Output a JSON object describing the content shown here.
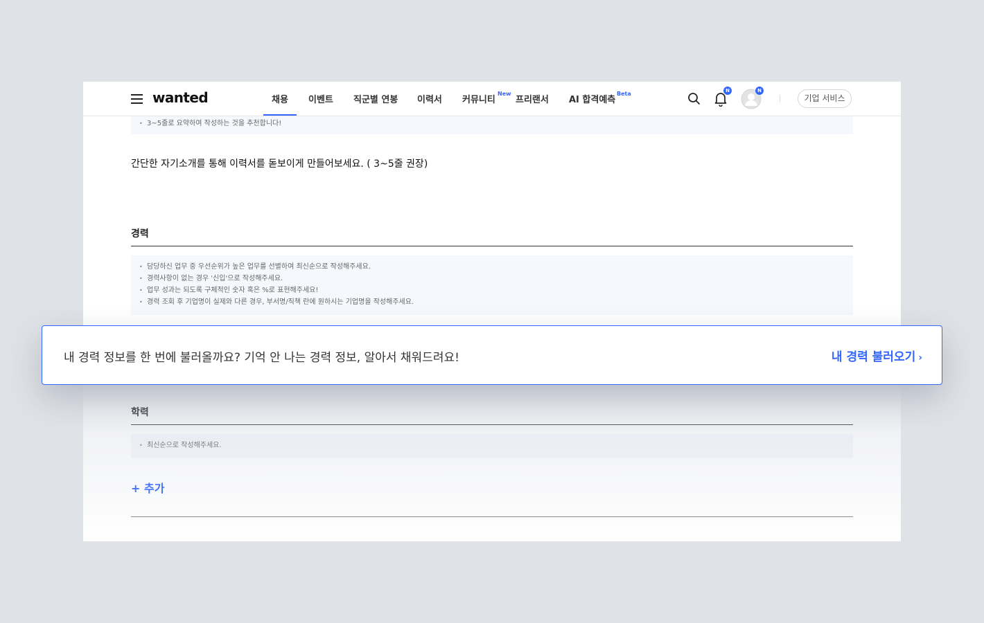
{
  "nav": {
    "logo": "wanted",
    "menu": [
      "채용",
      "이벤트",
      "직군별 연봉",
      "이력서",
      "커뮤니티",
      "프리랜서",
      "AI 합격예측"
    ],
    "menu_active_index": 0,
    "community_badge": "New",
    "ai_badge": "Beta",
    "notification_badge": "N",
    "profile_badge": "N",
    "corp_button": "기업 서비스",
    "icons": [
      "menu-icon",
      "search-icon",
      "bell-icon",
      "avatar-icon"
    ]
  },
  "intro": {
    "tip": "3~5줄로 요약하여 작성하는 것을 추천합니다!",
    "placeholder": "간단한 자기소개를 통해 이력서를 돋보이게 만들어보세요. ( 3~5줄 권장)"
  },
  "career": {
    "title": "경력",
    "tips": [
      "담당하신 업무 중 우선순위가 높은 업무를 선별하여 최신순으로 작성해주세요.",
      "경력사항이 없는 경우 '신입'으로 작성해주세요.",
      "업무 성과는 되도록 구체적인 숫자 혹은 %로 표현해주세요!",
      "경력 조회 후 기업명이 실제와 다른 경우, 부서명/직책 란에 원하시는 기업명을 작성해주세요."
    ]
  },
  "education": {
    "title": "학력",
    "tip": "최신순으로 작성해주세요.",
    "add_label": "+ 추가"
  },
  "banner": {
    "text": "내 경력 정보를 한 번에 불러올까요? 기억 안 나는 경력 정보, 알아서 채워드려요!",
    "link": "내 경력 불러오기",
    "chevron": "›"
  },
  "colors": {
    "accent": "#3366ff",
    "background": "#dfe2e6",
    "notice_bg": "#f5f8fc"
  }
}
